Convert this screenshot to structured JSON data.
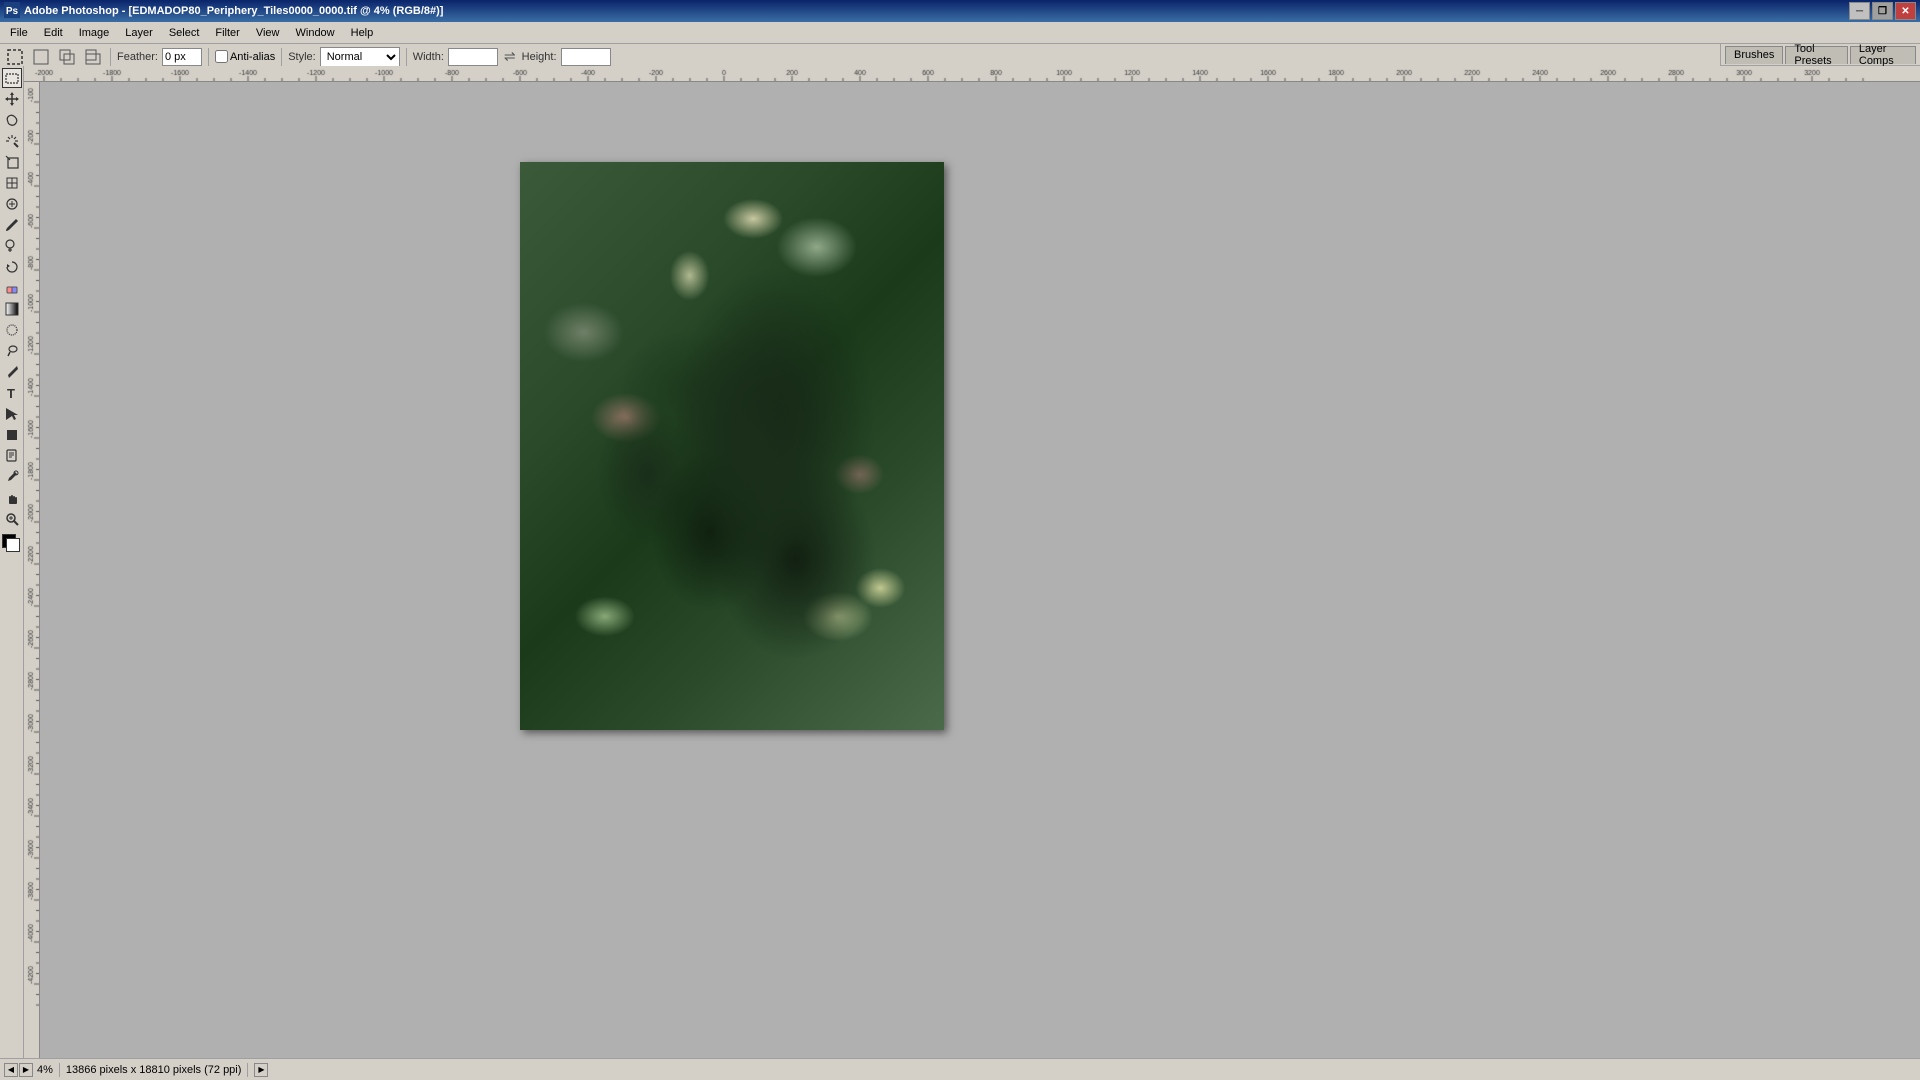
{
  "titlebar": {
    "title": "Adobe Photoshop - [EDMADOP80_Periphery_Tiles0000_0000.tif @ 4% (RGB/8#)]",
    "icon": "🖼",
    "minimize_label": "─",
    "maximize_label": "□",
    "restore_label": "❐",
    "close_label": "✕"
  },
  "menubar": {
    "items": [
      "File",
      "Edit",
      "Image",
      "Layer",
      "Select",
      "Filter",
      "View",
      "Window",
      "Help"
    ]
  },
  "toolbar": {
    "feather_label": "Feather:",
    "feather_value": "0 px",
    "antialias_label": "Anti-alias",
    "style_label": "Style:",
    "style_value": "Normal",
    "width_label": "Width:",
    "width_value": "",
    "height_label": "Height:",
    "height_value": ""
  },
  "options_tabs": {
    "brushes": "Brushes",
    "tool_presets": "Tool Presets",
    "layer_comps": "Layer Comps"
  },
  "tools": {
    "items": [
      {
        "name": "marquee",
        "icon": "▭",
        "tooltip": "Marquee"
      },
      {
        "name": "move",
        "icon": "✛",
        "tooltip": "Move"
      },
      {
        "name": "lasso",
        "icon": "⌒",
        "tooltip": "Lasso"
      },
      {
        "name": "magic-wand",
        "icon": "✦",
        "tooltip": "Magic Wand"
      },
      {
        "name": "crop",
        "icon": "⊡",
        "tooltip": "Crop"
      },
      {
        "name": "slice",
        "icon": "⊘",
        "tooltip": "Slice"
      },
      {
        "name": "healing-brush",
        "icon": "⊕",
        "tooltip": "Healing Brush"
      },
      {
        "name": "brush",
        "icon": "✏",
        "tooltip": "Brush"
      },
      {
        "name": "clone-stamp",
        "icon": "⎘",
        "tooltip": "Clone Stamp"
      },
      {
        "name": "history-brush",
        "icon": "↺",
        "tooltip": "History Brush"
      },
      {
        "name": "eraser",
        "icon": "◻",
        "tooltip": "Eraser"
      },
      {
        "name": "gradient",
        "icon": "▦",
        "tooltip": "Gradient"
      },
      {
        "name": "blur",
        "icon": "◎",
        "tooltip": "Blur"
      },
      {
        "name": "dodge",
        "icon": "◕",
        "tooltip": "Dodge"
      },
      {
        "name": "pen",
        "icon": "✒",
        "tooltip": "Pen"
      },
      {
        "name": "type",
        "icon": "T",
        "tooltip": "Type"
      },
      {
        "name": "path-selection",
        "icon": "↗",
        "tooltip": "Path Selection"
      },
      {
        "name": "shape",
        "icon": "■",
        "tooltip": "Shape"
      },
      {
        "name": "notes",
        "icon": "✎",
        "tooltip": "Notes"
      },
      {
        "name": "eyedropper",
        "icon": "✿",
        "tooltip": "Eyedropper"
      },
      {
        "name": "hand",
        "icon": "✋",
        "tooltip": "Hand"
      },
      {
        "name": "zoom",
        "icon": "🔍",
        "tooltip": "Zoom"
      }
    ]
  },
  "rulers": {
    "h_labels": [
      "-2000",
      "-1600",
      "-1400",
      "-1200",
      "-1000",
      "-800",
      "-600",
      "-400",
      "-200",
      "0",
      "200",
      "400",
      "600",
      "800",
      "1000",
      "1200",
      "1400",
      "1600",
      "1800",
      "2000",
      "2200",
      "2400",
      "2600",
      "2800",
      "3000"
    ],
    "v_labels": [
      "-100",
      "-200",
      "-400",
      "-600",
      "-800",
      "-1000",
      "-1200",
      "-1400",
      "-1600",
      "-1800",
      "-2000",
      "-2200",
      "-2400",
      "-2600",
      "-2800",
      "-3000",
      "-3200",
      "-3400",
      "-3600",
      "-3800",
      "-4000"
    ]
  },
  "statusbar": {
    "info": "13866 pixels x 18810 pixels (72 ppi)",
    "zoom": "4%"
  }
}
